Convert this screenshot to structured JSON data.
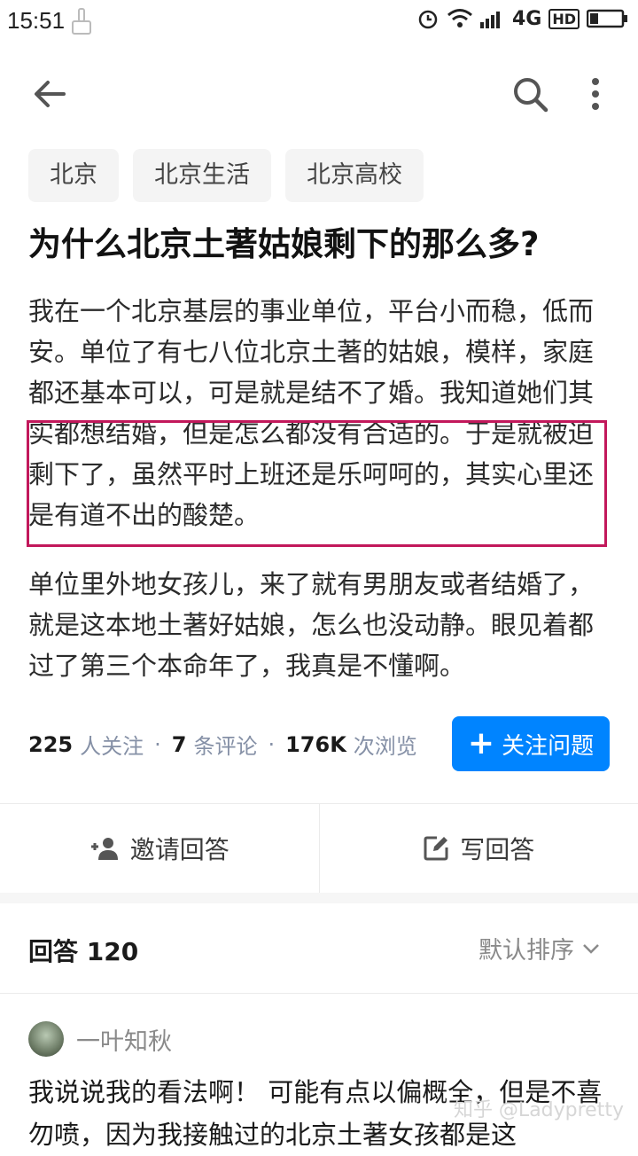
{
  "status_bar": {
    "time": "15:51",
    "network": "4G",
    "hd_badge": "HD",
    "icons": [
      "broom-icon",
      "alarm-icon",
      "wifi-icon",
      "signal-icon",
      "battery-icon"
    ]
  },
  "app_bar": {
    "icons": [
      "back-arrow-icon",
      "search-icon",
      "more-vertical-icon"
    ]
  },
  "tags": [
    "北京",
    "北京生活",
    "北京高校"
  ],
  "question": {
    "title": "为什么北京土著姑娘剩下的那么多?",
    "para1": "我在一个北京基层的事业单位，平台小而稳，低而安。单位了有七八位北京土著的姑娘，模样，家庭都还基本可以，可是就是结不了婚。我知道她们其实都想结婚，但是怎么都没有合适的。于是就被迫剩下了，虽然平时上班还是乐呵呵的，其实心里还是有道不出的酸楚。",
    "para2": "单位里外地女孩儿，来了就有男朋友或者结婚了，就是这本地土著好姑娘，怎么也没动静。眼见着都过了第三个本命年了，我真是不懂啊。",
    "highlight_color": "#c2185b"
  },
  "stats": {
    "followers_count": "225",
    "followers_label": "人关注",
    "comments_count": "7",
    "comments_label": "条评论",
    "views_count": "176K",
    "views_label": "次浏览",
    "separator": "·"
  },
  "follow_button": {
    "label": "关注问题",
    "icon": "+",
    "color": "#0084ff"
  },
  "actions": {
    "invite_label": "邀请回答",
    "write_label": "写回答"
  },
  "answers": {
    "title": "回答 120",
    "sort_label": "默认排序"
  },
  "first_answer": {
    "author": "一叶知秋",
    "text": "我说说我的看法啊！ 可能有点以偏概全，但是不喜勿喷，因为我接触过的北京土著女孩都是这"
  },
  "watermark": "知乎 @Ladypretty"
}
